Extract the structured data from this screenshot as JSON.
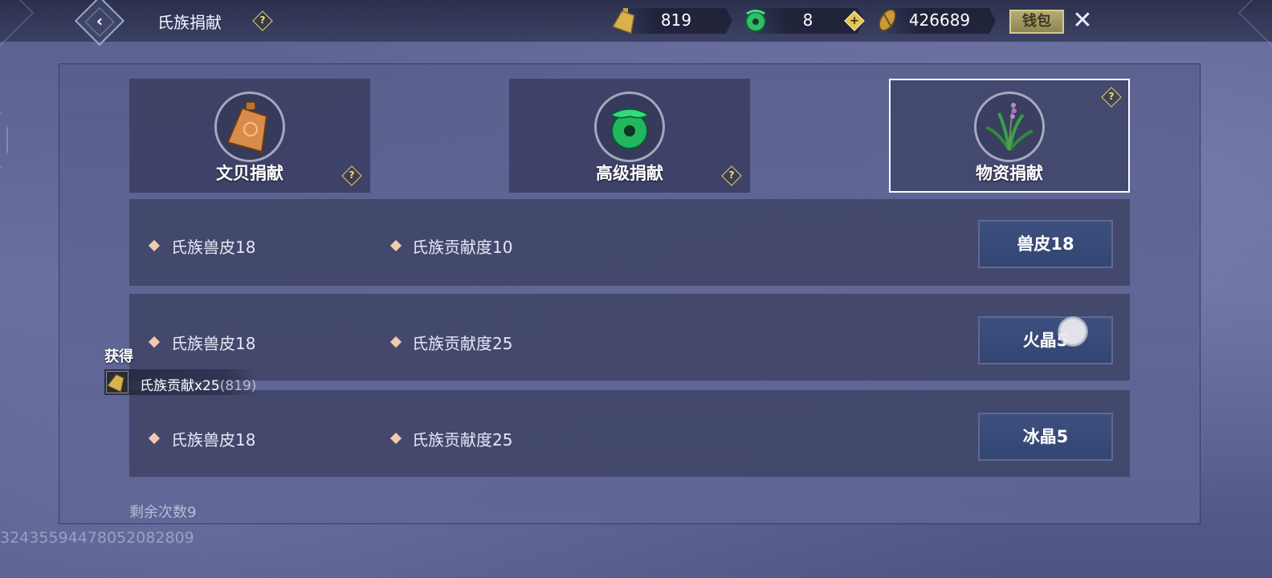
{
  "header": {
    "title": "氏族捐献",
    "help_symbol": "?",
    "wallet_label": "钱包",
    "close_symbol": "✕",
    "back_symbol": "‹",
    "plus_symbol": "+"
  },
  "currencies": [
    {
      "icon": "bell-coin-icon",
      "value": "819"
    },
    {
      "icon": "jade-icon",
      "value": "8"
    },
    {
      "icon": "cowrie-shell-icon",
      "value": "426689"
    }
  ],
  "tabs": [
    {
      "label": "文贝捐献",
      "icon": "bronze-bell-icon",
      "active": false
    },
    {
      "label": "高级捐献",
      "icon": "green-jade-icon",
      "active": false
    },
    {
      "label": "物资捐献",
      "icon": "herb-plant-icon",
      "active": true
    }
  ],
  "rows": [
    {
      "cost": "氏族兽皮18",
      "reward": "氏族贡献度10",
      "button": "兽皮18"
    },
    {
      "cost": "氏族兽皮18",
      "reward": "氏族贡献度25",
      "button": "火晶5"
    },
    {
      "cost": "氏族兽皮18",
      "reward": "氏族贡献度25",
      "button": "冰晶5"
    }
  ],
  "remaining": "剩余次数9",
  "footer_id": "32435594478052082809",
  "gain": {
    "label": "获得",
    "item": "氏族贡献",
    "amount": "x25",
    "total": "(819)"
  },
  "colors": {
    "accent_gold": "#e7d27a",
    "button_blue": "#3c4f7e",
    "bullet": "#f1cbb0"
  }
}
